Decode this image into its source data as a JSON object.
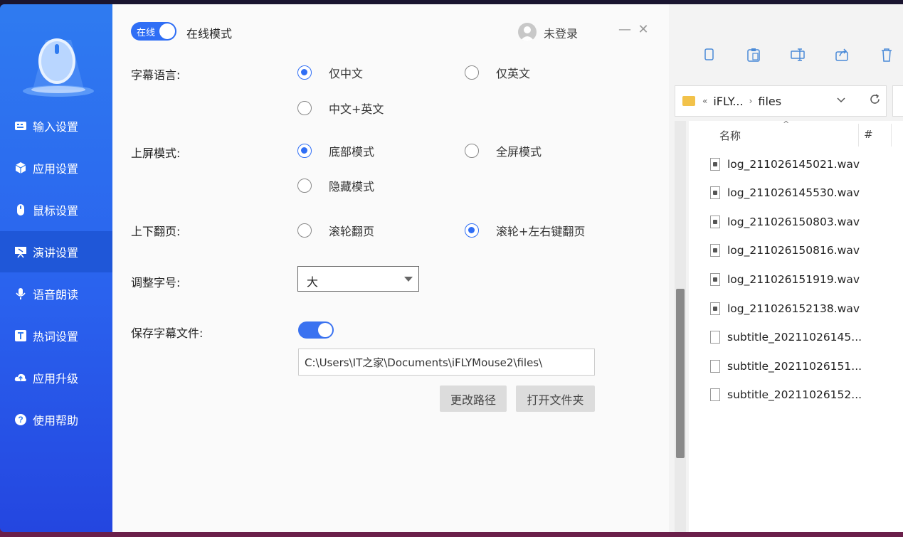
{
  "sidebar": {
    "items": [
      {
        "label": "输入设置",
        "icon": "keyboard-icon"
      },
      {
        "label": "应用设置",
        "icon": "cube-icon"
      },
      {
        "label": "鼠标设置",
        "icon": "mouse-icon"
      },
      {
        "label": "演讲设置",
        "icon": "presentation-icon"
      },
      {
        "label": "语音朗读",
        "icon": "microphone-icon"
      },
      {
        "label": "热词设置",
        "icon": "text-icon"
      },
      {
        "label": "应用升级",
        "icon": "cloud-upload-icon"
      },
      {
        "label": "使用帮助",
        "icon": "help-icon"
      }
    ],
    "active_index": 3
  },
  "header": {
    "online_toggle_label": "在线",
    "mode_label": "在线模式",
    "user_label": "未登录",
    "minimize": "—",
    "close": "✕"
  },
  "settings": {
    "subtitle_language": {
      "label": "字幕语言:",
      "options": [
        "仅中文",
        "仅英文",
        "中文+英文"
      ],
      "selected": "仅中文"
    },
    "display_mode": {
      "label": "上屏模式:",
      "options": [
        "底部模式",
        "全屏模式",
        "隐藏模式"
      ],
      "selected": "底部模式"
    },
    "page_turn": {
      "label": "上下翻页:",
      "options": [
        "滚轮翻页",
        "滚轮+左右键翻页"
      ],
      "selected": "滚轮+左右键翻页"
    },
    "font_size": {
      "label": "调整字号:",
      "value": "大"
    },
    "save_subtitle": {
      "label": "保存字幕文件:",
      "enabled": true,
      "path": "C:\\Users\\IT之家\\Documents\\iFLYMouse2\\files\\",
      "change_path_label": "更改路径",
      "open_folder_label": "打开文件夹"
    }
  },
  "explorer": {
    "address": {
      "seg1": "iFLY...",
      "seg2": "files",
      "back": "«",
      "sep": "›"
    },
    "columns": {
      "name": "名称",
      "sort": "^",
      "hash": "#"
    },
    "files": [
      {
        "name": "log_211026145021.wav",
        "type": "wav"
      },
      {
        "name": "log_211026145530.wav",
        "type": "wav"
      },
      {
        "name": "log_211026150803.wav",
        "type": "wav"
      },
      {
        "name": "log_211026150816.wav",
        "type": "wav"
      },
      {
        "name": "log_211026151919.wav",
        "type": "wav"
      },
      {
        "name": "log_211026152138.wav",
        "type": "wav"
      },
      {
        "name": "subtitle_20211026145...",
        "type": "txt"
      },
      {
        "name": "subtitle_20211026151...",
        "type": "txt"
      },
      {
        "name": "subtitle_20211026152...",
        "type": "txt"
      }
    ],
    "toolbar_icons": [
      "copy-icon",
      "paste-icon",
      "rename-icon",
      "share-icon",
      "delete-icon"
    ]
  },
  "colors": {
    "accent": "#2f6ef5",
    "sidebar_top": "#2f7bf0",
    "sidebar_bottom": "#2446e0",
    "sidebar_active": "#1f57d8"
  }
}
